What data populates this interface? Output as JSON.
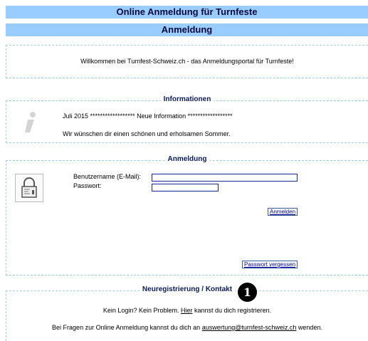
{
  "header": {
    "title": "Online Anmeldung für Turnfeste",
    "subtitle": "Anmeldung"
  },
  "welcome": {
    "text": "Willkommen bei Turnfest-Schweiz.ch - das Anmeldungsportal für Turnfeste!"
  },
  "info": {
    "legend": "Informationen",
    "line1": "Juli 2015 ****************** Neue Information ******************",
    "line2": "Wir wünschen dir einen schönen und erholsamen Sommer."
  },
  "login": {
    "legend": "Anmeldung",
    "username_label": "Benutzername (E-Mail):",
    "password_label": "Passwort:",
    "username_value": "",
    "password_value": "",
    "login_button": "Anmelden",
    "forgot_button": "Passwort vergessen"
  },
  "register": {
    "legend": "Neuregistrierung / Kontakt",
    "line1_pre": "Kein Login? Kein Problem.",
    "line1_link": "Hier",
    "line1_post": "kannst du dich registrieren.",
    "line2_pre": "Bei Fragen zur Online Anmeldung kannst du dich an",
    "line2_link": "auswertung@turnfest-schweiz.ch",
    "line2_post": "wenden."
  },
  "badge": {
    "number": "1"
  }
}
